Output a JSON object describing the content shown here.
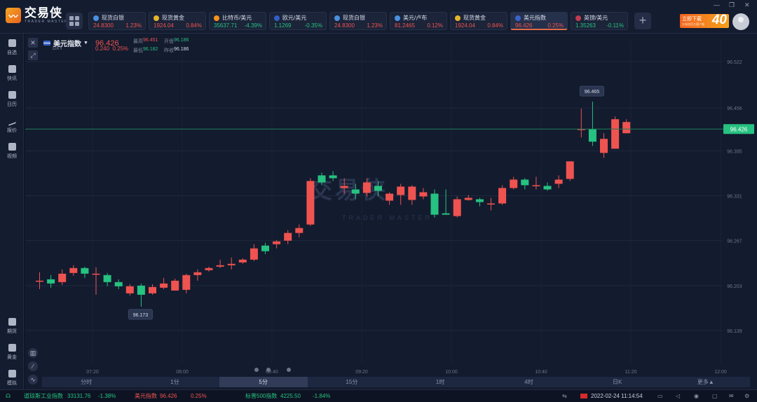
{
  "app": {
    "name": "交易侠",
    "name_en": "TRADER MASTER",
    "window_controls": [
      "—",
      "❐",
      "✕"
    ]
  },
  "tabs": [
    {
      "label": "现货白银",
      "price": "24.8300",
      "change": "1.23%",
      "dir": "up",
      "icon": "silver-icon",
      "icon_color": "#4a90e2"
    },
    {
      "label": "现货黄金",
      "price": "1924.04",
      "change": "0.84%",
      "dir": "up",
      "icon": "gold-icon",
      "icon_color": "#e5b52b"
    },
    {
      "label": "比特币/美元",
      "price": "35637.71",
      "change": "-4.39%",
      "dir": "down",
      "icon": "bitcoin-icon",
      "icon_color": "#f7931a"
    },
    {
      "label": "欧元/美元",
      "price": "1.1269",
      "change": "-0.35%",
      "dir": "down",
      "icon": "eu-flag-icon",
      "icon_color": "#2f5fc4"
    },
    {
      "label": "现货白银",
      "price": "24.8300",
      "change": "1.23%",
      "dir": "up",
      "icon": "silver-icon",
      "icon_color": "#4a90e2"
    },
    {
      "label": "美元/卢布",
      "price": "81.2465",
      "change": "0.12%",
      "dir": "up",
      "icon": "bar-chart-icon",
      "icon_color": "#4a90e2"
    },
    {
      "label": "现货黄金",
      "price": "1924.04",
      "change": "0.84%",
      "dir": "up",
      "icon": "gold-icon",
      "icon_color": "#e5b52b"
    },
    {
      "label": "美元指数",
      "price": "96.426",
      "change": "0.25%",
      "dir": "up",
      "icon": "us-flag-icon",
      "icon_color": "#3a63c9",
      "active": true
    },
    {
      "label": "英镑/美元",
      "price": "1.35263",
      "change": "-0.11%",
      "dir": "down",
      "icon": "uk-flag-icon",
      "icon_color": "#c23b4e"
    }
  ],
  "promo": {
    "line1": "立即下载",
    "line2": "交易侠官方客户端",
    "big": "40"
  },
  "sidebar": {
    "top": [
      {
        "label": "自选",
        "icon": "bookmark-icon"
      },
      {
        "label": "快讯",
        "icon": "news-icon"
      },
      {
        "label": "日历",
        "icon": "calendar-icon"
      },
      {
        "label": "报价",
        "icon": "trend-icon"
      },
      {
        "label": "视频",
        "icon": "video-icon"
      }
    ],
    "bottom": [
      {
        "label": "期货",
        "icon": "futures-icon"
      },
      {
        "label": "黄金",
        "icon": "gold-bar-icon"
      },
      {
        "label": "模拟",
        "icon": "wallet-icon"
      }
    ]
  },
  "symbol": {
    "name": "美元指数",
    "code": "DXY",
    "price": "96.426",
    "change": "0.240",
    "change_pct": "0.25%",
    "high_label": "最高",
    "high": "96.451",
    "open_label": "开盘",
    "open": "96.186",
    "low_label": "最低",
    "low": "96.182",
    "prev_label": "昨收",
    "prev": "96.186"
  },
  "watermark": {
    "cn": "交易侠",
    "en": "TRADER MASTER"
  },
  "chart_data": {
    "type": "candlestick",
    "price_axis": [
      "96.522",
      "96.456",
      "96.395",
      "96.331",
      "96.267",
      "96.203",
      "96.139"
    ],
    "time_axis": [
      "07:20",
      "08:00",
      "08:40",
      "09:20",
      "10:00",
      "10:40",
      "11:20",
      "12:00"
    ],
    "last_price": "96.426",
    "max_label": "96.465",
    "min_label": "96.173",
    "candles": [
      {
        "o": 96.21,
        "c": 96.21,
        "h": 96.222,
        "l": 96.198
      },
      {
        "o": 96.212,
        "c": 96.206,
        "h": 96.218,
        "l": 96.2
      },
      {
        "o": 96.208,
        "c": 96.22,
        "h": 96.226,
        "l": 96.204
      },
      {
        "o": 96.221,
        "c": 96.228,
        "h": 96.232,
        "l": 96.217
      },
      {
        "o": 96.228,
        "c": 96.22,
        "h": 96.23,
        "l": 96.214
      },
      {
        "o": 96.22,
        "c": 96.22,
        "h": 96.229,
        "l": 96.19
      },
      {
        "o": 96.218,
        "c": 96.208,
        "h": 96.221,
        "l": 96.202
      },
      {
        "o": 96.208,
        "c": 96.202,
        "h": 96.212,
        "l": 96.198
      },
      {
        "o": 96.192,
        "c": 96.202,
        "h": 96.205,
        "l": 96.189
      },
      {
        "o": 96.203,
        "c": 96.19,
        "h": 96.206,
        "l": 96.173
      },
      {
        "o": 96.192,
        "c": 96.201,
        "h": 96.205,
        "l": 96.19
      },
      {
        "o": 96.2,
        "c": 96.206,
        "h": 96.214,
        "l": 96.198
      },
      {
        "o": 96.196,
        "c": 96.21,
        "h": 96.213,
        "l": 96.196
      },
      {
        "o": 96.197,
        "c": 96.218,
        "h": 96.22,
        "l": 96.192
      },
      {
        "o": 96.218,
        "c": 96.222,
        "h": 96.226,
        "l": 96.21
      },
      {
        "o": 96.225,
        "c": 96.228,
        "h": 96.23,
        "l": 96.223
      },
      {
        "o": 96.23,
        "c": 96.232,
        "h": 96.24,
        "l": 96.228
      },
      {
        "o": 96.232,
        "c": 96.234,
        "h": 96.243,
        "l": 96.226
      },
      {
        "o": 96.236,
        "c": 96.24,
        "h": 96.242,
        "l": 96.234
      },
      {
        "o": 96.24,
        "c": 96.256,
        "h": 96.262,
        "l": 96.238
      },
      {
        "o": 96.26,
        "c": 96.252,
        "h": 96.264,
        "l": 96.248
      },
      {
        "o": 96.262,
        "c": 96.266,
        "h": 96.268,
        "l": 96.256
      },
      {
        "o": 96.267,
        "c": 96.278,
        "h": 96.282,
        "l": 96.262
      },
      {
        "o": 96.278,
        "c": 96.285,
        "h": 96.29,
        "l": 96.272
      },
      {
        "o": 96.29,
        "c": 96.352,
        "h": 96.356,
        "l": 96.288
      },
      {
        "o": 96.36,
        "c": 96.35,
        "h": 96.364,
        "l": 96.346
      },
      {
        "o": 96.36,
        "c": 96.356,
        "h": 96.366,
        "l": 96.352
      },
      {
        "o": 96.342,
        "c": 96.345,
        "h": 96.356,
        "l": 96.334
      },
      {
        "o": 96.34,
        "c": 96.334,
        "h": 96.348,
        "l": 96.326
      },
      {
        "o": 96.335,
        "c": 96.35,
        "h": 96.356,
        "l": 96.33
      },
      {
        "o": 96.345,
        "c": 96.338,
        "h": 96.352,
        "l": 96.33
      },
      {
        "o": 96.324,
        "c": 96.334,
        "h": 96.336,
        "l": 96.318
      },
      {
        "o": 96.332,
        "c": 96.344,
        "h": 96.348,
        "l": 96.318
      },
      {
        "o": 96.325,
        "c": 96.344,
        "h": 96.346,
        "l": 96.318
      },
      {
        "o": 96.33,
        "c": 96.336,
        "h": 96.342,
        "l": 96.326
      },
      {
        "o": 96.334,
        "c": 96.304,
        "h": 96.34,
        "l": 96.3
      },
      {
        "o": 96.306,
        "c": 96.304,
        "h": 96.34,
        "l": 96.304
      },
      {
        "o": 96.302,
        "c": 96.326,
        "h": 96.33,
        "l": 96.3
      },
      {
        "o": 96.325,
        "c": 96.328,
        "h": 96.332,
        "l": 96.324
      },
      {
        "o": 96.326,
        "c": 96.322,
        "h": 96.328,
        "l": 96.316
      },
      {
        "o": 96.32,
        "c": 96.32,
        "h": 96.328,
        "l": 96.31
      },
      {
        "o": 96.32,
        "c": 96.342,
        "h": 96.346,
        "l": 96.318
      },
      {
        "o": 96.342,
        "c": 96.354,
        "h": 96.358,
        "l": 96.34
      },
      {
        "o": 96.354,
        "c": 96.346,
        "h": 96.356,
        "l": 96.34
      },
      {
        "o": 96.345,
        "c": 96.346,
        "h": 96.358,
        "l": 96.34
      },
      {
        "o": 96.345,
        "c": 96.34,
        "h": 96.35,
        "l": 96.338
      },
      {
        "o": 96.348,
        "c": 96.354,
        "h": 96.36,
        "l": 96.342
      },
      {
        "o": 96.355,
        "c": 96.38,
        "h": 96.38,
        "l": 96.352
      },
      {
        "o": 96.425,
        "c": 96.426,
        "h": 96.455,
        "l": 96.414
      },
      {
        "o": 96.426,
        "c": 96.408,
        "h": 96.465,
        "l": 96.402
      },
      {
        "o": 96.392,
        "c": 96.412,
        "h": 96.42,
        "l": 96.385
      },
      {
        "o": 96.398,
        "c": 96.44,
        "h": 96.444,
        "l": 96.398
      },
      {
        "o": 96.42,
        "c": 96.436,
        "h": 96.44,
        "l": 96.42
      }
    ]
  },
  "periods": [
    "分时",
    "1分",
    "5分",
    "15分",
    "1时",
    "4时",
    "日K",
    "更多▲"
  ],
  "active_period": "5分",
  "bottom_tickers": [
    {
      "label": "道琼斯工业指数",
      "price": "33131.76",
      "change": "-1.38%",
      "dir": "down"
    },
    {
      "label": "美元指数",
      "price": "96.426",
      "change": "0.25%",
      "dir": "up"
    },
    {
      "label": "标普500指数",
      "price": "4225.50",
      "change": "-1.84%",
      "dir": "down"
    }
  ],
  "datetime": "2022-02-24 11:14:54"
}
